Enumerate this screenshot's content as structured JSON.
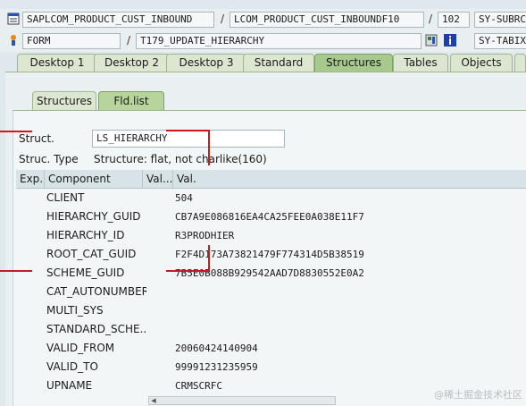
{
  "toolbar": {
    "program": "SAPLCOM_PRODUCT_CUST_INBOUND",
    "include": "LCOM_PRODUCT_CUST_INBOUNDF10",
    "line": "102",
    "sysvar1": "SY-SUBRC",
    "event_type": "FORM",
    "event_name": "T179_UPDATE_HIERARCHY",
    "sysvar2": "SY-TABIX"
  },
  "tabs": [
    {
      "label": "Desktop 1"
    },
    {
      "label": "Desktop 2"
    },
    {
      "label": "Desktop 3"
    },
    {
      "label": "Standard"
    },
    {
      "label": "Structures",
      "active": true
    },
    {
      "label": "Tables"
    },
    {
      "label": "Objects"
    }
  ],
  "subtabs": [
    {
      "label": "Structures"
    },
    {
      "label": "Fld.list",
      "active": true
    }
  ],
  "struct": {
    "label": "Struct.",
    "value": "LS_HIERARCHY",
    "type_label": "Struc. Type",
    "type_value": "Structure: flat, not charlike(160)"
  },
  "table": {
    "headers": [
      "Exp.",
      "Component",
      "Val...",
      "Val."
    ],
    "rows": [
      {
        "component": "CLIENT",
        "value": "504"
      },
      {
        "component": "HIERARCHY_GUID",
        "value": "CB7A9E086816EA4CA25FEE0A038E11F7"
      },
      {
        "component": "HIERARCHY_ID",
        "value": "R3PRODHIER"
      },
      {
        "component": "ROOT_CAT_GUID",
        "value": "F2F4D173A73821479F774314D5B38519"
      },
      {
        "component": "SCHEME_GUID",
        "value": "7B5E0B088B929542AAD7D8830552E0A2"
      },
      {
        "component": "CAT_AUTONUMBER",
        "value": ""
      },
      {
        "component": "MULTI_SYS",
        "value": ""
      },
      {
        "component": "STANDARD_SCHE...",
        "value": ""
      },
      {
        "component": "VALID_FROM",
        "value": "20060424140904"
      },
      {
        "component": "VALID_TO",
        "value": "99991231235959"
      },
      {
        "component": "UPNAME",
        "value": "CRMSCRFC"
      }
    ]
  },
  "watermark": "@稀土掘金技术社区",
  "colors": {
    "accent_tab": "#a8c98d",
    "annotation": "#d2161d"
  }
}
